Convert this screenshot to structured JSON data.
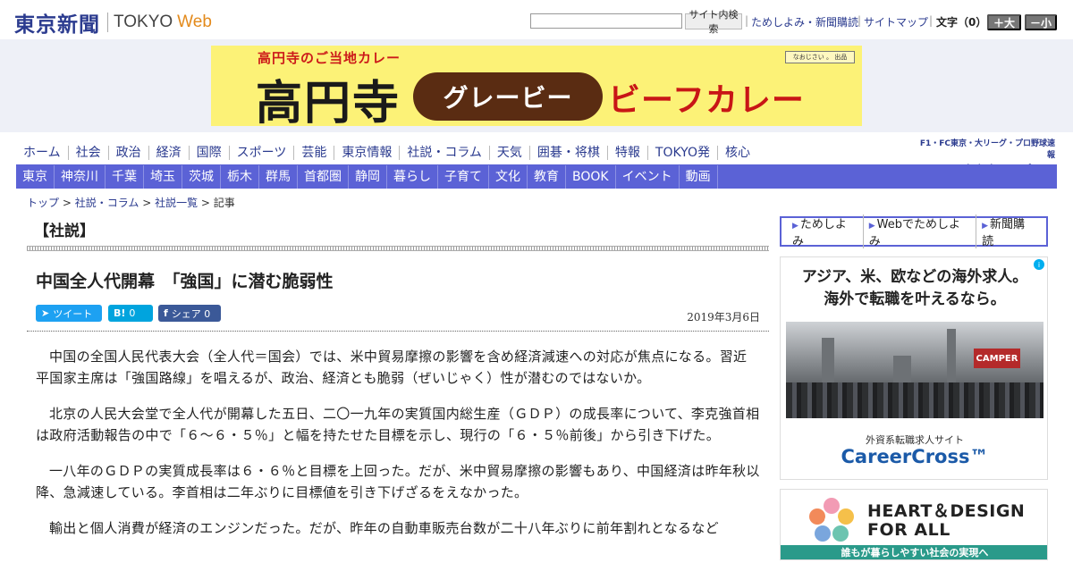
{
  "header": {
    "logo_jp": "東京新聞",
    "logo_en": "TOKYO",
    "logo_web": "Web",
    "search_button": "サイト内検索",
    "links": [
      "ためしよみ・新聞購読",
      "サイトマップ"
    ],
    "font_size_label": "文字（0）",
    "font_bigger": "＋大",
    "font_smaller": "－小"
  },
  "banner": {
    "subtitle": "高円寺のご当地カレー",
    "kanji": "高円寺",
    "pill": "グレービー",
    "red": "ビーフカレー",
    "badge": "なおじさい 。 出品"
  },
  "nav_main": [
    "ホーム",
    "社会",
    "政治",
    "経済",
    "国際",
    "スポーツ",
    "芸能",
    "東京情報",
    "社説・コラム",
    "天気",
    "囲碁・将棋",
    "特報",
    "TOKYO発",
    "核心"
  ],
  "chunichi": {
    "top": "F1・FC東京・大リーグ・プロ野球速報",
    "logo": "▶東京中日スポーツ"
  },
  "nav_region": [
    "東京",
    "神奈川",
    "千葉",
    "埼玉",
    "茨城",
    "栃木",
    "群馬",
    "首都圏",
    "静岡",
    "暮らし",
    "子育て",
    "文化",
    "教育",
    "BOOK",
    "イベント",
    "動画"
  ],
  "breadcrumb": [
    "トップ",
    "社説・コラム",
    "社説一覧",
    "記事"
  ],
  "article": {
    "section": "【社説】",
    "title": "中国全人代開幕　「強国」に潜む脆弱性",
    "share": {
      "tweet": "ツイート",
      "hatena_icon": "B!",
      "hatena_count": "0",
      "fb_icon": "f",
      "fb_label": "シェア 0"
    },
    "date": "2019年3月6日",
    "paragraphs": [
      "中国の全国人民代表大会（全人代＝国会）では、米中貿易摩擦の影響を含め経済減速への対応が焦点になる。習近平国家主席は「強国路線」を唱えるが、政治、経済とも脆弱（ぜいじゃく）性が潜むのではないか。",
      "北京の人民大会堂で全人代が開幕した五日、二〇一九年の実質国内総生産（ＧＤＰ）の成長率について、李克強首相は政府活動報告の中で「６～６・５％」と幅を持たせた目標を示し、現行の「６・５％前後」から引き下げた。",
      "一八年のＧＤＰの実質成長率は６・６％と目標を上回った。だが、米中貿易摩擦の影響もあり、中国経済は昨年秋以降、急減速している。李首相は二年ぶりに目標値を引き下げざるをえなかった。",
      "輸出と個人消費が経済のエンジンだった。だが、昨年の自動車販売台数が二十八年ぶりに前年割れとなるなど"
    ]
  },
  "sidebar": {
    "subscribe": [
      "ためしよみ",
      "Webでためしよみ",
      "新聞購読"
    ],
    "ad1": {
      "line1": "アジア、米、欧などの海外求人。",
      "line2": "海外で転職を叶えるなら。",
      "photo_sign": "CAMPER",
      "sub": "外資系転職求人サイト",
      "brand": "CareerCross™"
    },
    "ad2": {
      "line1": "HEART＆DESIGN",
      "line2": "FOR ALL",
      "bar": "誰もが暮らしやすい社会の実現へ"
    }
  }
}
